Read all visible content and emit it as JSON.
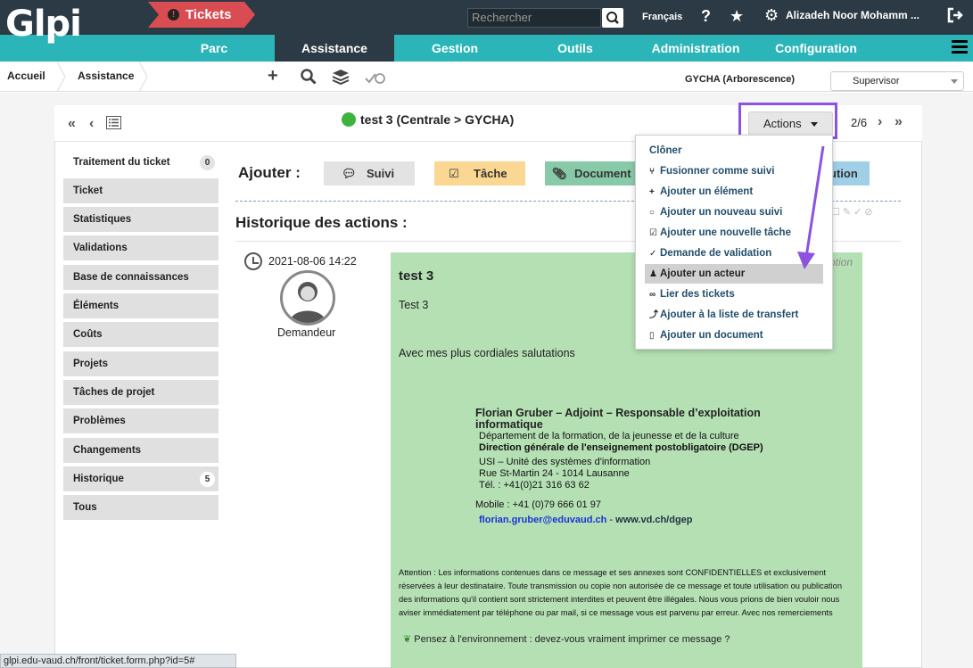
{
  "header": {
    "logo_text": "Glpi",
    "search_placeholder": "Rechercher",
    "language": "Français",
    "user": "Alizadeh Noor Mohamm ..."
  },
  "nav": {
    "items": [
      "Parc",
      "Assistance",
      "Gestion",
      "Outils",
      "Administration",
      "Configuration"
    ],
    "active": "Assistance"
  },
  "breadcrumb": {
    "home": "Accueil",
    "section": "Assistance",
    "current": "Tickets"
  },
  "entity": "GYCHA (Arborescence)",
  "profile": "Supervisor",
  "ticket": {
    "title": "test 3 (Centrale > GYCHA)",
    "pager": "2/6",
    "actions_label": "Actions"
  },
  "tabs": [
    {
      "label": "Traitement du ticket",
      "badge": "0"
    },
    {
      "label": "Ticket",
      "badge": ""
    },
    {
      "label": "Statistiques",
      "badge": ""
    },
    {
      "label": "Validations",
      "badge": ""
    },
    {
      "label": "Base de connaissances",
      "badge": ""
    },
    {
      "label": "Éléments",
      "badge": ""
    },
    {
      "label": "Coûts",
      "badge": ""
    },
    {
      "label": "Projets",
      "badge": ""
    },
    {
      "label": "Tâches de projet",
      "badge": ""
    },
    {
      "label": "Problèmes",
      "badge": ""
    },
    {
      "label": "Changements",
      "badge": ""
    },
    {
      "label": "Historique",
      "badge": "5"
    },
    {
      "label": "Tous",
      "badge": ""
    }
  ],
  "add_bar": {
    "label": "Ajouter :",
    "suivi": "Suivi",
    "tache": "Tâche",
    "document": "Document",
    "solution_partial": "ution"
  },
  "history": {
    "title": "Historique des actions :",
    "date": "2021-08-06 14:22",
    "role": "Demandeur",
    "ghost": "otion"
  },
  "message": {
    "title": "test 3",
    "body": "Test 3",
    "greeting": "Avec mes plus cordiales salutations",
    "sig_name": "Florian Gruber – Adjoint – Responsable d’exploitation informatique",
    "sig_dept": "Département de la formation, de la jeunesse et de la culture",
    "sig_dir": "Direction générale de l'enseignement postobligatoire (DGEP)",
    "sig_usi": "USI – Unité des systèmes d'information",
    "sig_addr": "Rue St-Martin 24 - 1014 Lausanne",
    "sig_tel": "Tél. : +41(0)21 316 63 62",
    "sig_mobile": "Mobile : +41 (0)79 666 01 97",
    "sig_email": "florian.gruber@eduvaud.ch",
    "sig_sep": " - ",
    "sig_web": "www.vd.ch/dgep",
    "disclaimer": "Attention : Les informations contenues dans ce message et ses annexes sont CONFIDENTIELLES et exclusivement réservées à leur destinataire. Toute transmission ou copie non autorisée de ce message et toute utilisation ou publication des informations qu'il contient sont strictement interdites et peuvent être illégales. Nous vous prions de bien vouloir nous aviser immédiatement par téléphone ou par mail, si ce message vous est parvenu par erreur. Avec nos remerciements",
    "eco": "Pensez à l'environnement : devez-vous vraiment imprimer ce message ?"
  },
  "actions_menu": [
    {
      "label": "Clôner",
      "icon": ""
    },
    {
      "label": "Fusionner comme suivi",
      "icon": "merge-icon"
    },
    {
      "label": "Ajouter un élément",
      "icon": "plus-icon"
    },
    {
      "label": "Ajouter un nouveau suivi",
      "icon": "comment-icon"
    },
    {
      "label": "Ajouter une nouvelle tâche",
      "icon": "checkbox-icon"
    },
    {
      "label": "Demande de validation",
      "icon": "check-icon"
    },
    {
      "label": "Ajouter un acteur",
      "icon": "user-icon"
    },
    {
      "label": "Lier des tickets",
      "icon": "link-icon"
    },
    {
      "label": "Ajouter à la liste de transfert",
      "icon": "transfer-icon"
    },
    {
      "label": "Ajouter un document",
      "icon": "file-icon"
    }
  ],
  "statusbar": "glpi.edu-vaud.ch/front/ticket.form.php?id=5#",
  "colors": {
    "topbar": "#2b3a44",
    "nav": "#2bb5b9",
    "tickets_crumb": "#d94c52",
    "highlight": "#8b53e0",
    "message_bg": "#b4e0b4"
  }
}
